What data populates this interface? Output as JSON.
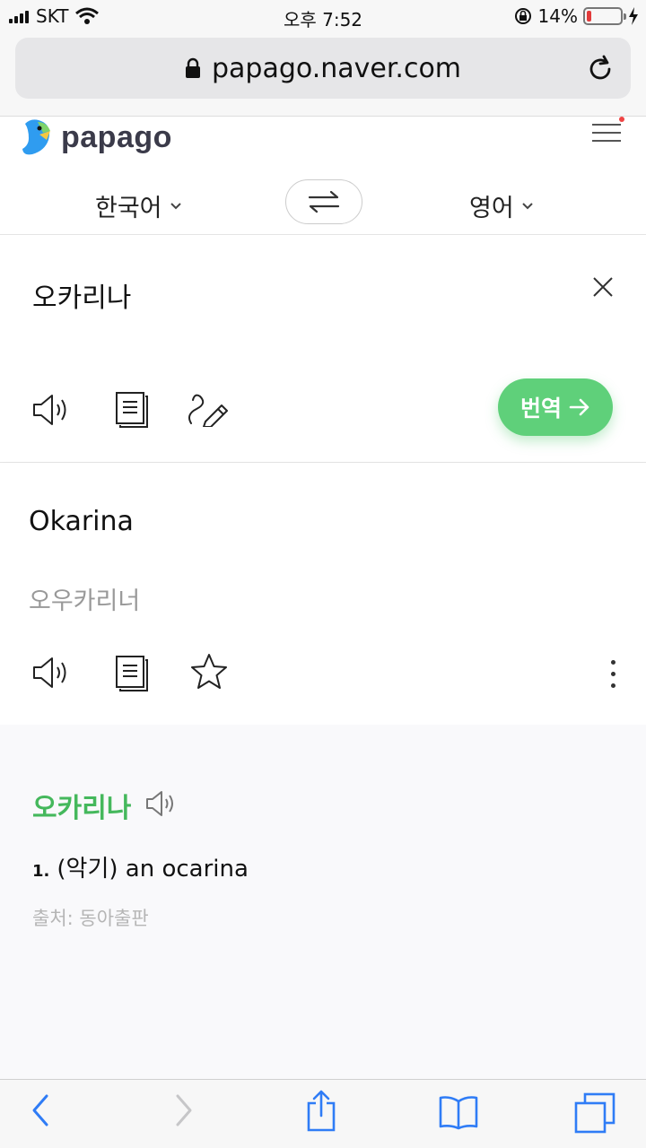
{
  "status_bar": {
    "carrier": "SKT",
    "time": "오후 7:52",
    "battery_percent": "14%",
    "battery_level": 0.14,
    "icons": [
      "signal-icon",
      "wifi-icon",
      "orientation-lock-icon",
      "battery-icon",
      "charging-icon"
    ]
  },
  "browser": {
    "url": "papago.naver.com",
    "icons": [
      "lock-icon",
      "reload-icon"
    ]
  },
  "header": {
    "logo_text": "papago",
    "source_lang": "한국어",
    "target_lang": "영어",
    "icons": [
      "papago-logo-icon",
      "menu-icon",
      "swap-icon",
      "chevron-down-icon"
    ]
  },
  "input": {
    "text": "오카리나",
    "translate_label": "번역",
    "icons": [
      "speaker-icon",
      "copy-icon",
      "handwriting-icon",
      "close-icon",
      "arrow-right-icon"
    ]
  },
  "output": {
    "text": "Okarina",
    "pronunciation": "오우카리너",
    "icons": [
      "speaker-icon",
      "copy-icon",
      "star-icon",
      "more-vertical-icon"
    ]
  },
  "dictionary": {
    "word": "오카리나",
    "definition_number": "1.",
    "definition": "(악기) an ocarina",
    "source": "출처: 동아출판"
  },
  "toolbar": {
    "icons": [
      "back-icon",
      "forward-icon",
      "share-icon",
      "bookmarks-icon",
      "tabs-icon"
    ]
  },
  "colors": {
    "accent_green": "#5fd07a",
    "dict_green": "#45b85c",
    "ios_blue": "#2f7cf6"
  }
}
